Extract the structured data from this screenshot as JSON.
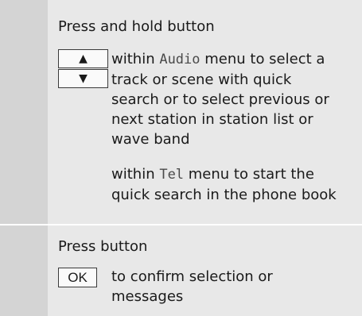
{
  "colors": {
    "left_cell": "#d4d4d4",
    "right_cell": "#e8e8e8",
    "key_border": "#3a3a3a"
  },
  "rows": [
    {
      "heading": "Press and hold button",
      "keys": [
        {
          "icon": "arrow-up-icon",
          "glyph": "▲"
        },
        {
          "icon": "arrow-down-icon",
          "glyph": "▼"
        }
      ],
      "entries": [
        {
          "prefix": "within ",
          "menu": "Audio",
          "text_lines": [
            " menu to select a",
            "track or scene with quick",
            "search or to select previous or",
            "next station in station list or",
            "wave band"
          ]
        },
        {
          "prefix": "within ",
          "menu": "Tel",
          "text_lines": [
            " menu to start the",
            "quick search in the phone book"
          ]
        }
      ]
    },
    {
      "heading": "Press button",
      "keys": [
        {
          "icon": "ok-key",
          "glyph": "OK"
        }
      ],
      "entries": [
        {
          "text_lines": [
            "to confirm selection or",
            "messages"
          ]
        }
      ]
    }
  ]
}
